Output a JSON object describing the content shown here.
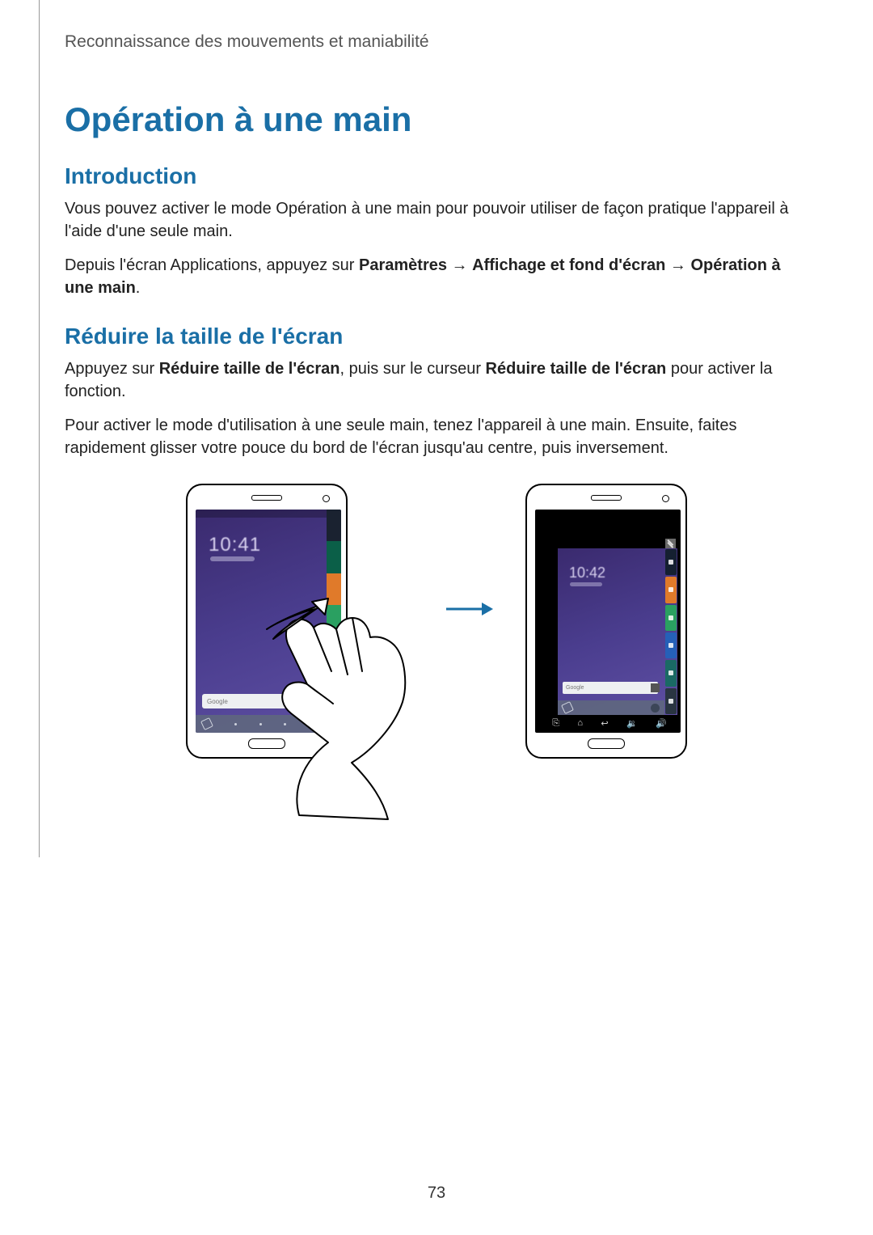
{
  "header": {
    "running_title": "Reconnaissance des mouvements et maniabilité"
  },
  "h1": "Opération à une main",
  "sections": {
    "intro": {
      "title": "Introduction",
      "p1": "Vous pouvez activer le mode Opération à une main pour pouvoir utiliser de façon pratique l'appareil à l'aide d'une seule main.",
      "p2_prefix": "Depuis l'écran Applications, appuyez sur ",
      "p2_bold1": "Paramètres",
      "p2_arrow1": " → ",
      "p2_bold2": "Affichage et fond d'écran",
      "p2_arrow2": " → ",
      "p2_bold3": "Opération à une main",
      "p2_suffix": "."
    },
    "reduce": {
      "title": "Réduire la taille de l'écran",
      "p1_prefix": "Appuyez sur ",
      "p1_bold1": "Réduire taille de l'écran",
      "p1_mid": ", puis sur le curseur ",
      "p1_bold2": "Réduire taille de l'écran",
      "p1_suffix": " pour activer la fonction.",
      "p2": "Pour activer le mode d'utilisation à une seule main, tenez l'appareil à une main. Ensuite, faites rapidement glisser votre pouce du bord de l'écran jusqu'au centre, puis inversement."
    }
  },
  "figure": {
    "left_clock": "10:41",
    "right_clock": "10:42",
    "search_label": "Google",
    "softkeys": {
      "recent": "⎘",
      "home": "⌂",
      "back": "↩",
      "vol_down": "🔉",
      "vol_up": "🔊"
    }
  },
  "page_number": "73"
}
